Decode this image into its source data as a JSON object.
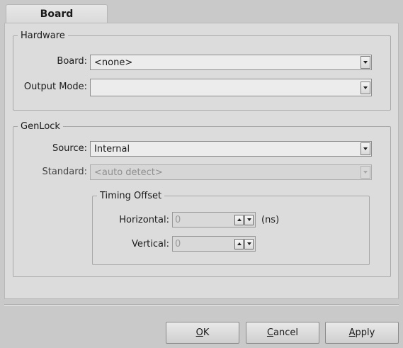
{
  "tab": {
    "label": "Board"
  },
  "hardware": {
    "legend": "Hardware",
    "board_label": "Board:",
    "board_value": "<none>",
    "output_mode_label": "Output Mode:",
    "output_mode_value": ""
  },
  "genlock": {
    "legend": "GenLock",
    "source_label": "Source:",
    "source_value": "Internal",
    "standard_label": "Standard:",
    "standard_value": "<auto detect>",
    "timing": {
      "legend": "Timing Offset",
      "horizontal_label": "Horizontal:",
      "horizontal_value": "0",
      "horizontal_unit": "(ns)",
      "vertical_label": "Vertical:",
      "vertical_value": "0"
    }
  },
  "buttons": {
    "ok_mnemonic": "O",
    "ok_rest": "K",
    "cancel_mnemonic": "C",
    "cancel_rest": "ancel",
    "apply_mnemonic": "A",
    "apply_rest": "pply"
  },
  "icons": {
    "dropdown": "chevron-down-icon",
    "spin_up": "arrow-up-icon",
    "spin_down": "arrow-down-icon"
  }
}
